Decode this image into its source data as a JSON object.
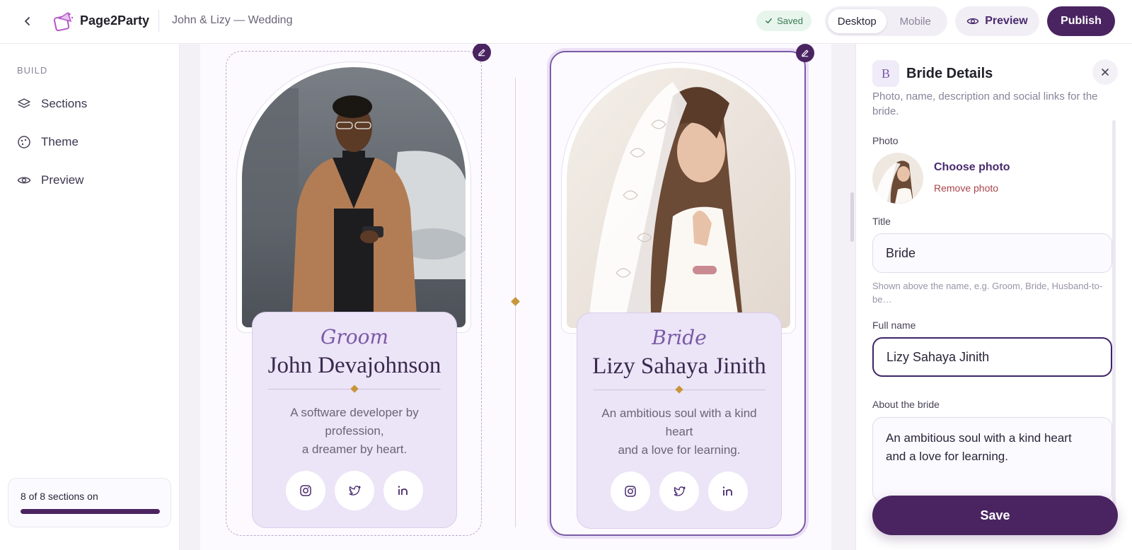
{
  "topbar": {
    "brand": "Page2Party",
    "project_name": "John & Lizy — Wedding",
    "saved_label": "Saved",
    "device_options": [
      {
        "label": "Desktop",
        "active": true
      },
      {
        "label": "Mobile",
        "active": false
      }
    ],
    "preview_label": "Preview",
    "publish_label": "Publish"
  },
  "sidebar": {
    "section_label": "BUILD",
    "items": [
      {
        "label": "Sections",
        "icon": "layers-icon"
      },
      {
        "label": "Theme",
        "icon": "palette-icon"
      },
      {
        "label": "Preview",
        "icon": "eye-icon"
      }
    ],
    "progress": {
      "text": "8 of 8 sections on",
      "fraction": 1.0
    }
  },
  "canvas": {
    "groom": {
      "role": "Groom",
      "name": "John Devajohnson",
      "description_lines": [
        "A software developer by profession,",
        "a dreamer by heart."
      ],
      "socials": [
        "instagram-icon",
        "twitter-icon",
        "linkedin-icon"
      ]
    },
    "bride": {
      "role": "Bride",
      "name": "Lizy Sahaya Jinith",
      "description_lines": [
        "An ambitious soul with a kind heart",
        "and a love for learning."
      ],
      "socials": [
        "instagram-icon",
        "twitter-icon",
        "linkedin-icon"
      ]
    }
  },
  "panel": {
    "badge_letter": "B",
    "title": "Bride Details",
    "subtitle": "Photo, name, description and social links for the bride.",
    "photo_label": "Photo",
    "choose_photo": "Choose photo",
    "remove_photo": "Remove photo",
    "title_label": "Title",
    "title_value": "Bride",
    "title_hint": "Shown above the name, e.g. Groom, Bride, Husband-to-be…",
    "fullname_label": "Full name",
    "fullname_value": "Lizy Sahaya Jinith",
    "about_label": "About the bride",
    "about_value": "An ambitious soul with a kind heart\nand a love for learning.",
    "save_label": "Save"
  },
  "colors": {
    "primary": "#4a2461",
    "accent": "#7a5aa6",
    "gold": "#c8953a",
    "card_bg": "#ece4f7",
    "danger": "#a8454a",
    "saved_green": "#3b7a52"
  }
}
